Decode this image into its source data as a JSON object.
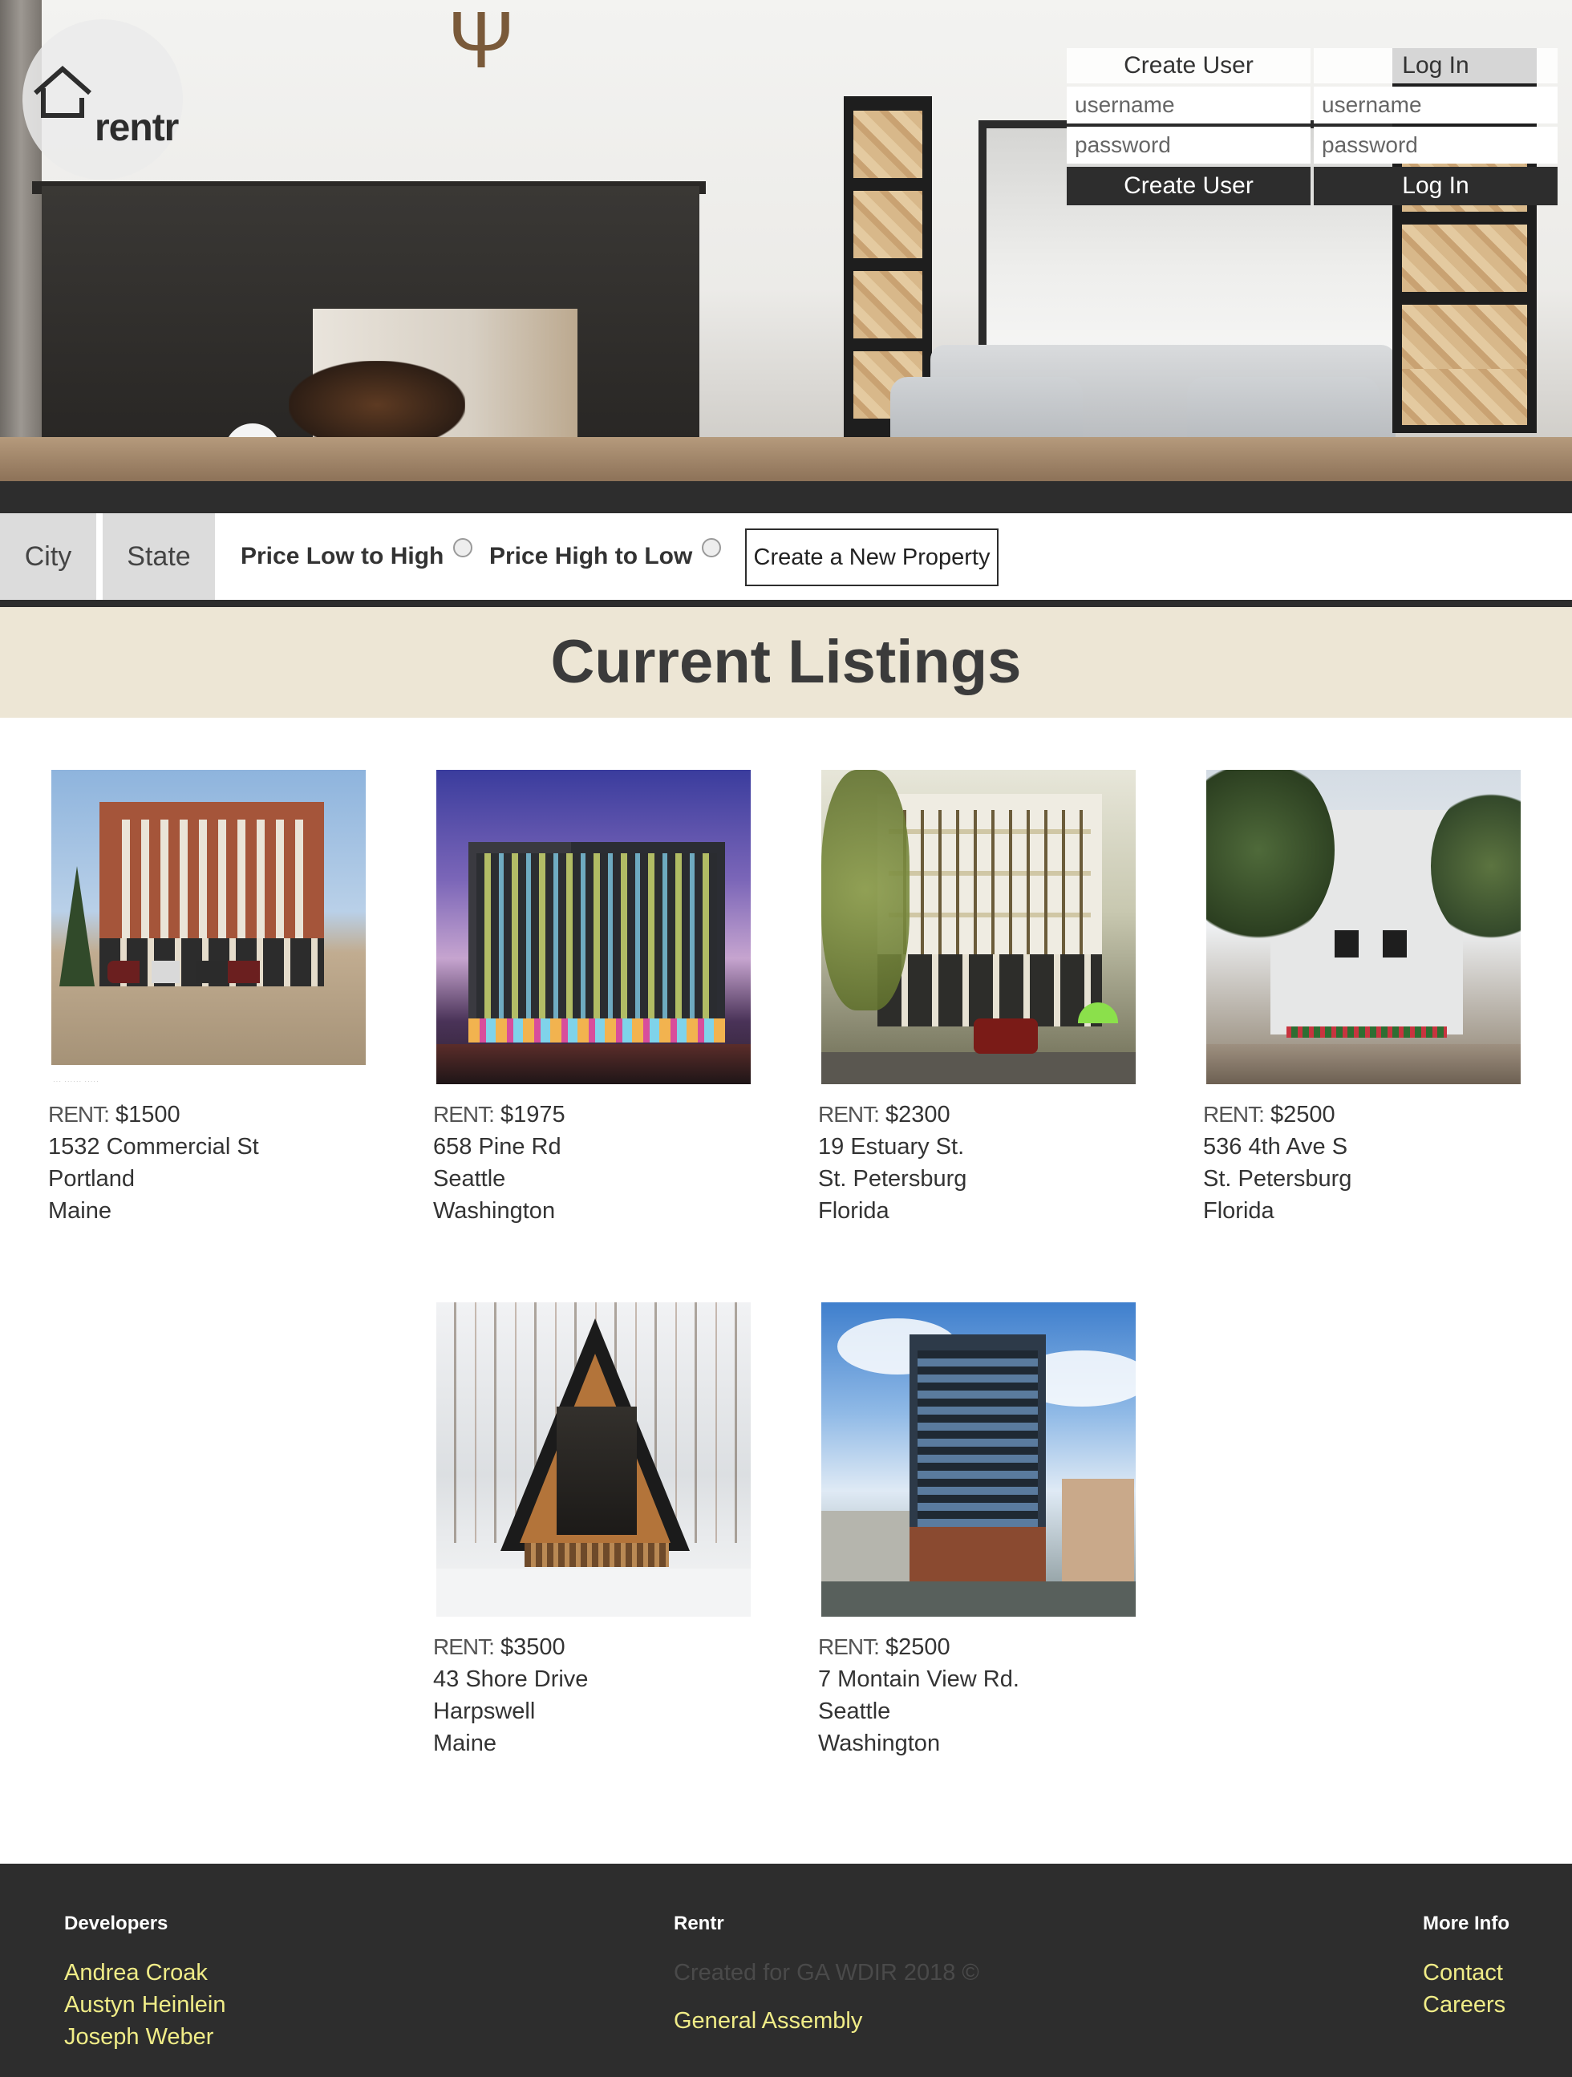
{
  "brand": {
    "logo_text": "rentr"
  },
  "auth": {
    "create": {
      "title": "Create User",
      "username_placeholder": "username",
      "password_placeholder": "password",
      "button": "Create User"
    },
    "login": {
      "title": "Log In",
      "username_placeholder": "username",
      "password_placeholder": "password",
      "button": "Log In"
    }
  },
  "filters": {
    "city": "City",
    "state": "State",
    "sort_low_high": "Price Low to High",
    "sort_high_low": "Price High to Low",
    "create_property": "Create a New Property"
  },
  "listings_title": "Current Listings",
  "rent_label": "RENT:",
  "listings": [
    {
      "rent": "$1500",
      "address": "1532 Commercial St",
      "city": "Portland",
      "state": "Maine"
    },
    {
      "rent": "$1975",
      "address": "658 Pine Rd",
      "city": "Seattle",
      "state": "Washington"
    },
    {
      "rent": "$2300",
      "address": "19 Estuary St.",
      "city": "St. Petersburg",
      "state": "Florida"
    },
    {
      "rent": "$2500",
      "address": "536 4th Ave S",
      "city": "St. Petersburg",
      "state": "Florida"
    },
    {
      "rent": "$3500",
      "address": "43 Shore Drive",
      "city": "Harpswell",
      "state": "Maine"
    },
    {
      "rent": "$2500",
      "address": "7 Montain View Rd.",
      "city": "Seattle",
      "state": "Washington"
    }
  ],
  "footer": {
    "developers": {
      "title": "Developers",
      "names": [
        "Andrea Croak",
        "Austyn Heinlein",
        "Joseph Weber"
      ]
    },
    "rentr": {
      "title": "Rentr",
      "credit": "Created for GA WDIR 2018 ©",
      "link": "General Assembly"
    },
    "more": {
      "title": "More Info",
      "links": [
        "Contact",
        "Careers"
      ]
    }
  },
  "colors": {
    "dark": "#2d2d2d",
    "title_band": "#ede6d5",
    "footer_link": "#f0ec87",
    "filter_tab": "#dcdcdc"
  }
}
